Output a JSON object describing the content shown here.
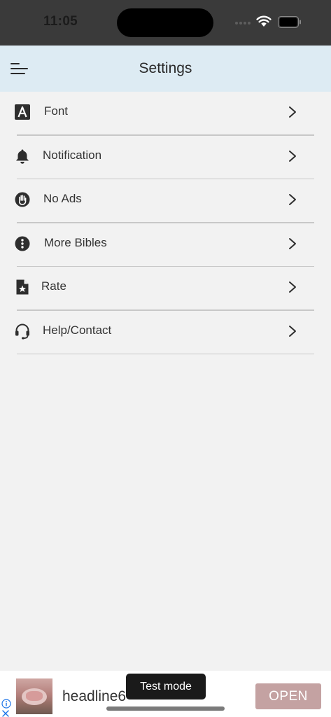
{
  "status_bar": {
    "time": "11:05"
  },
  "header": {
    "title": "Settings"
  },
  "settings_items": [
    {
      "label": "Font",
      "icon": "font-icon"
    },
    {
      "label": "Notification",
      "icon": "bell-icon"
    },
    {
      "label": "No Ads",
      "icon": "hand-stop-icon"
    },
    {
      "label": "More Bibles",
      "icon": "info-circle-icon"
    },
    {
      "label": "Rate",
      "icon": "star-document-icon"
    },
    {
      "label": "Help/Contact",
      "icon": "headset-icon"
    }
  ],
  "ad": {
    "headline": "headline6",
    "cta_label": "OPEN",
    "cta_color": "#c4a2a2"
  },
  "toast": {
    "text": "Test mode"
  },
  "colors": {
    "header_bg": "#ddebf3",
    "background": "#f2f2f2",
    "status_bar_bg": "#3a3a3a"
  }
}
